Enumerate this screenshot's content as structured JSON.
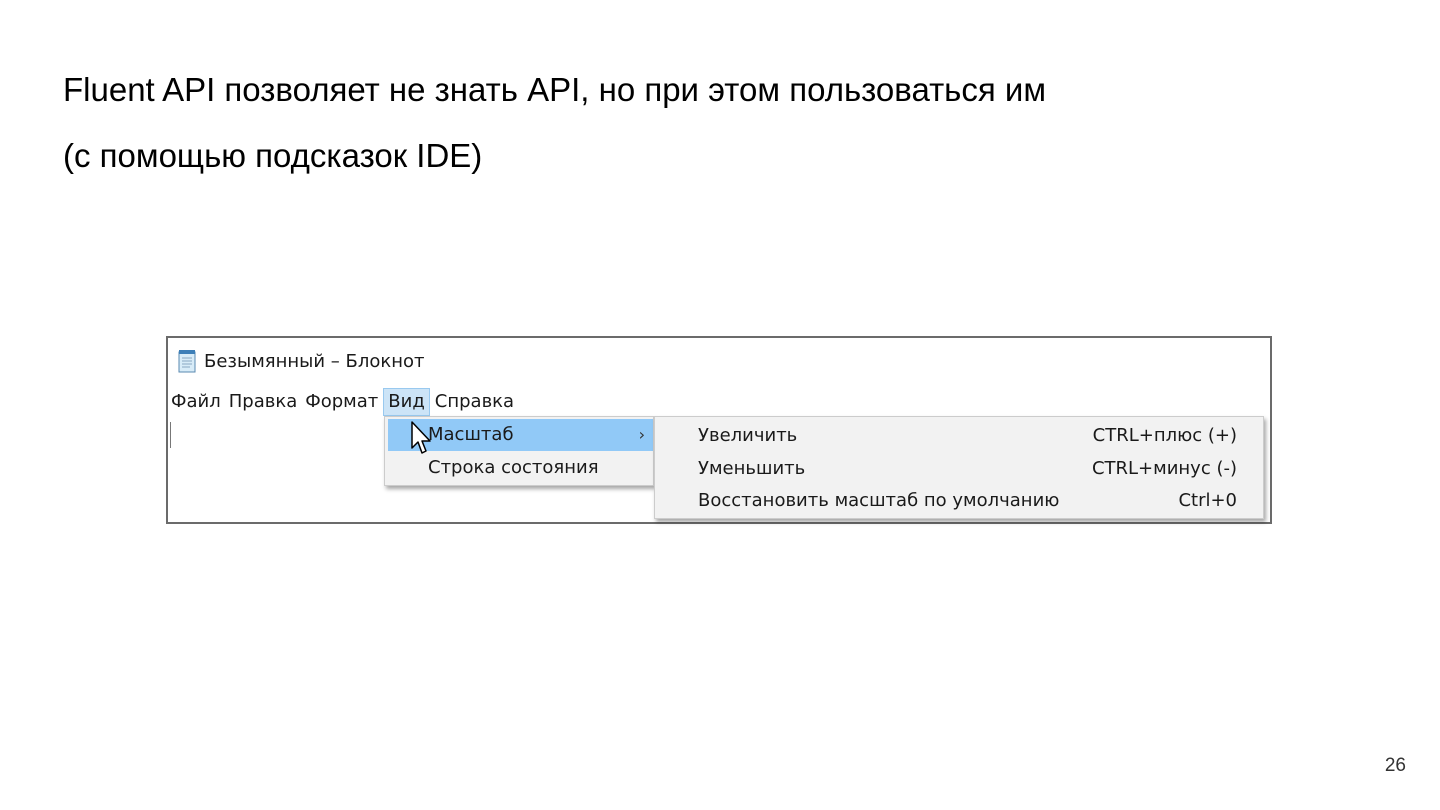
{
  "slide": {
    "title_line1": "Fluent API позволяет не знать API, но при этом пользоваться им",
    "title_line2": "(с помощью подсказок IDE)",
    "page_number": "26"
  },
  "window": {
    "title": "Безымянный – Блокнот",
    "icon": "notepad-icon",
    "menu": [
      "Файл",
      "Правка",
      "Формат",
      "Вид",
      "Справка"
    ],
    "active_menu": "Вид"
  },
  "view_menu": {
    "items": [
      {
        "label": "Масштаб",
        "has_submenu": true,
        "highlighted": true
      },
      {
        "label": "Строка состояния"
      }
    ],
    "chevron": "›"
  },
  "zoom_submenu": {
    "items": [
      {
        "label": "Увеличить",
        "shortcut": "CTRL+плюс (+)"
      },
      {
        "label": "Уменьшить",
        "shortcut": "CTRL+минус (-)"
      },
      {
        "label": "Восстановить масштаб по умолчанию",
        "shortcut": "Ctrl+0"
      }
    ]
  },
  "colors": {
    "highlight": "#91c9f7",
    "active_menu_bg": "#cce4f7",
    "menu_bg": "#f2f2f2",
    "window_border": "#6b6b6b"
  }
}
